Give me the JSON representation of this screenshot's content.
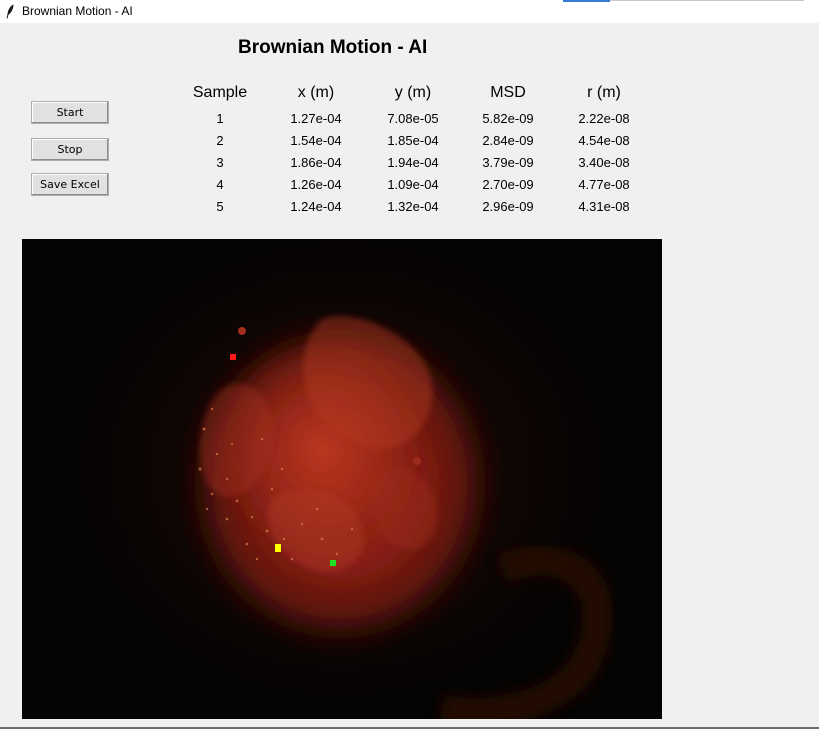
{
  "window": {
    "title": "Brownian Motion - AI"
  },
  "header": {
    "title": "Brownian Motion - AI"
  },
  "controls": {
    "start_label": "Start",
    "stop_label": "Stop",
    "save_label": "Save Excel"
  },
  "table": {
    "headers": [
      "Sample",
      "x (m)",
      "y (m)",
      "MSD",
      "r (m)"
    ],
    "rows": [
      [
        "1",
        "1.27e-04",
        "7.08e-05",
        "5.82e-09",
        "2.22e-08"
      ],
      [
        "2",
        "1.54e-04",
        "1.85e-04",
        "2.84e-09",
        "4.54e-08"
      ],
      [
        "3",
        "1.86e-04",
        "1.94e-04",
        "3.79e-09",
        "3.40e-08"
      ],
      [
        "4",
        "1.26e-04",
        "1.09e-04",
        "2.70e-09",
        "4.77e-08"
      ],
      [
        "5",
        "1.24e-04",
        "1.32e-04",
        "2.96e-09",
        "4.31e-08"
      ]
    ]
  },
  "video": {
    "markers": [
      {
        "name": "red-particle-marker",
        "color": "#ff1a1a"
      },
      {
        "name": "yellow-particle-marker",
        "color": "#ffff00"
      },
      {
        "name": "green-particle-marker",
        "color": "#22e022"
      }
    ]
  },
  "colors": {
    "background": "#f0f0f0",
    "video_background": "#050403",
    "accent": "#3a7bd5"
  },
  "icons": {
    "app": "feather-icon"
  }
}
